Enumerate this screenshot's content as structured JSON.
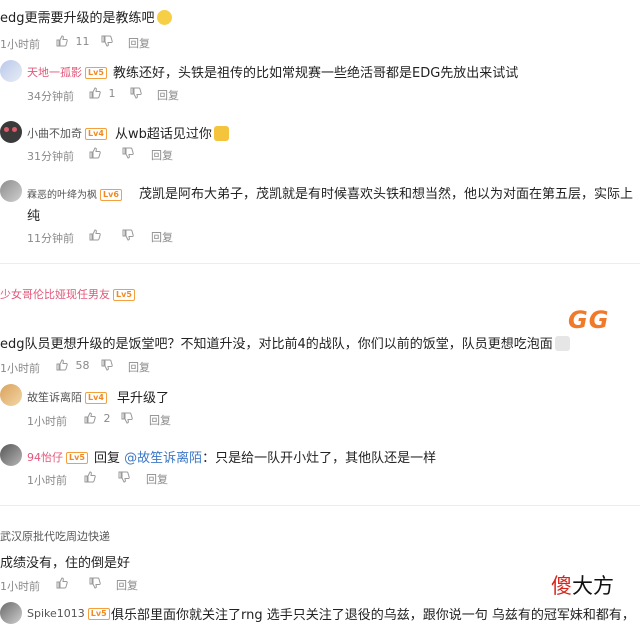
{
  "thread1": {
    "main": {
      "text": "edg更需要升级的是教练吧",
      "time": "1小时前",
      "likes": "11",
      "reply": "回复"
    },
    "replies": [
      {
        "user": "天地一孤影",
        "text": "教练还好，头铁是祖传的比如常规赛一些绝活哥都是EDG先放出来试试",
        "time": "34分钟前",
        "likes": "1",
        "reply": "回复"
      },
      {
        "user": "小曲不加奇",
        "text": "从wb超话见过你",
        "time": "31分钟前",
        "reply": "回复"
      },
      {
        "user": "霖恶的叶绛为枫",
        "text": "茂凯是阿布大弟子，茂凯就是有时候喜欢头铁和想当然，他以为对面在第五层，实际上",
        "text_cont": "纯",
        "time": "11分钟前",
        "reply": "回复"
      }
    ]
  },
  "thread2": {
    "user": "少女哥伦比娅现任男友",
    "main": {
      "text": "edg队员更想升级的是饭堂吧？不知道升没，对比前4的战队，你们以前的饭堂，队员更想吃泡面",
      "time": "1小时前",
      "likes": "58",
      "reply": "回复",
      "sticker": "GG"
    },
    "replies": [
      {
        "user": "故笙诉离陌",
        "text": "早升级了",
        "time": "1小时前",
        "likes": "2",
        "reply": "回复"
      },
      {
        "user": "94怡仔",
        "reply_prefix": "回复",
        "mention": "@故笙诉离陌",
        "text": "：只是给一队开小灶了，其他队还是一样",
        "time": "1小时前",
        "reply": "回复"
      }
    ]
  },
  "thread3": {
    "user": "武汉原批代吃周边快递",
    "main": {
      "text": "成绩没有，住的倒是好",
      "time": "1小时前",
      "reply": "回复"
    },
    "replies": [
      {
        "user": "Spike1013",
        "text": "俱乐部里面你就关注了rng 选手只关注了退役的乌兹，跟你说一句 乌兹有的冠军妹和都有，"
      }
    ]
  },
  "watermark": {
    "char1": "傻",
    "char2": "大方"
  },
  "colors": {
    "level_badge": "#f08a24",
    "pink_name": "#e2567a",
    "mention": "#3d78c7",
    "watermark_red": "#d9241c"
  },
  "icons": [
    "thumb-up-icon",
    "dislike-icon",
    "emoji-icon"
  ]
}
